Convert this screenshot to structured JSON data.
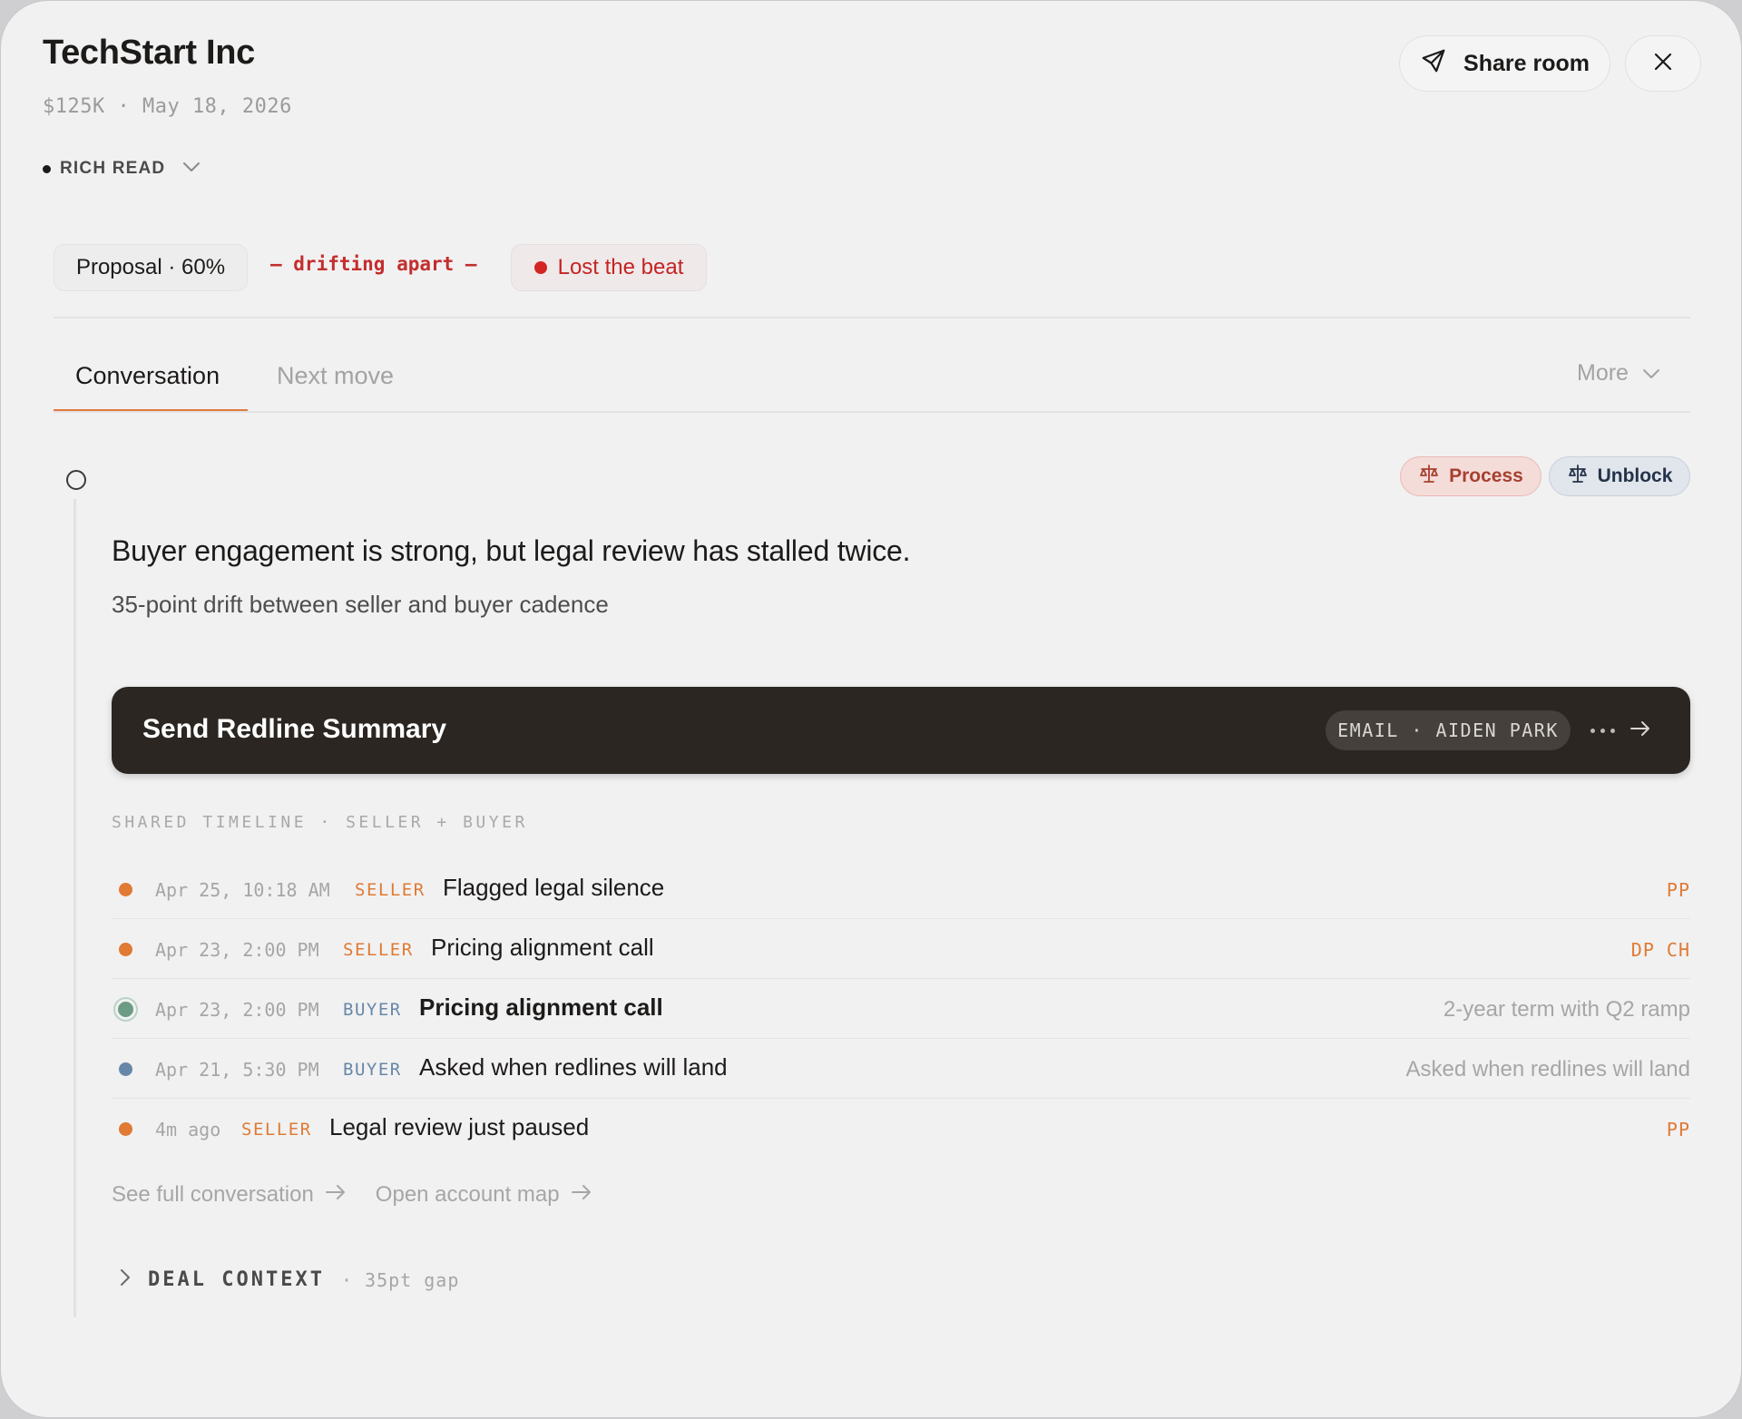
{
  "header": {
    "title": "TechStart Inc",
    "subtitle": "$125K · May 18, 2026",
    "share_label": "Share room"
  },
  "read_mode": {
    "label": "RICH READ"
  },
  "status": {
    "stage": "Proposal · 60%",
    "drift": "— drifting apart —",
    "lost": "Lost the beat"
  },
  "tabs": [
    {
      "label": "Conversation",
      "active": true
    },
    {
      "label": "Next move",
      "active": false
    }
  ],
  "more_label": "More",
  "tags": [
    {
      "label": "Process"
    },
    {
      "label": "Unblock"
    }
  ],
  "insight": {
    "headline": "Buyer engagement is strong, but legal review has stalled twice.",
    "subline": "35-point drift between seller and buyer cadence"
  },
  "action": {
    "title": "Send Redline Summary",
    "channel": "EMAIL · AIDEN PARK"
  },
  "timeline": {
    "label": "SHARED TIMELINE · SELLER + BUYER",
    "rows": [
      {
        "time": "Apr 25, 10:18 AM",
        "role": "SELLER",
        "title": "Flagged legal silence",
        "right": "PP"
      },
      {
        "time": "Apr 23, 2:00 PM",
        "role": "SELLER",
        "title": "Pricing alignment call",
        "right": "DP CH"
      },
      {
        "time": "Apr 23, 2:00 PM",
        "role": "BUYER",
        "title": "Pricing alignment call",
        "right": "2-year term with Q2 ramp"
      },
      {
        "time": "Apr 21, 5:30 PM",
        "role": "BUYER",
        "title": "Asked when redlines will land",
        "right": "Asked when redlines will land"
      },
      {
        "time": "4m ago",
        "role": "SELLER",
        "title": "Legal review just paused",
        "right": "PP"
      }
    ]
  },
  "links": {
    "conversation": "See full conversation",
    "account_map": "Open account map"
  },
  "deal_context": {
    "label": "DEAL CONTEXT",
    "gap": "· 35pt gap"
  },
  "colors": {
    "accent": "#e27a3b",
    "seller": "#e07a34",
    "buyer": "#6787a8",
    "alert": "#d42525",
    "action_bar": "#2b2622"
  }
}
